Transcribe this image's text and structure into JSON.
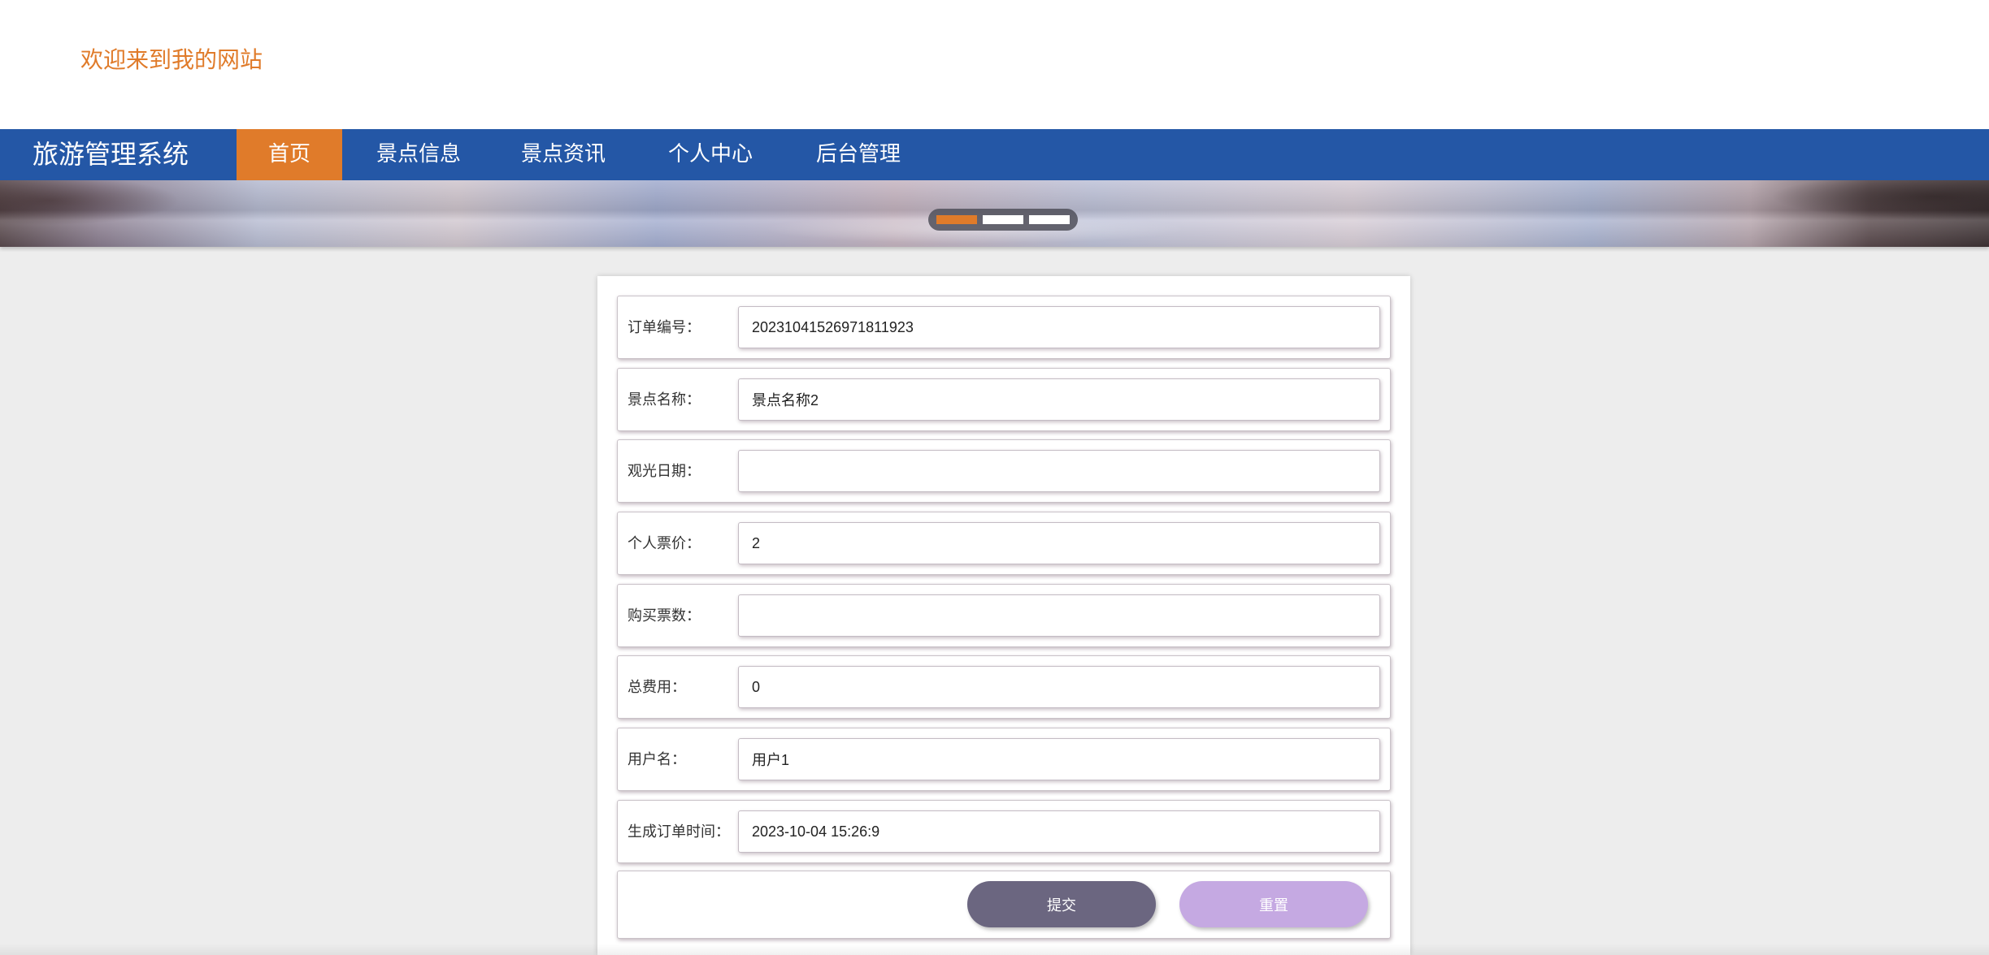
{
  "header": {
    "welcome_text": "欢迎来到我的网站"
  },
  "nav": {
    "brand": "旅游管理系统",
    "items": [
      {
        "label": "首页",
        "active": true
      },
      {
        "label": "景点信息",
        "active": false
      },
      {
        "label": "景点资讯",
        "active": false
      },
      {
        "label": "个人中心",
        "active": false
      },
      {
        "label": "后台管理",
        "active": false
      }
    ]
  },
  "carousel": {
    "slide_count": 3,
    "active_index": 0
  },
  "form": {
    "fields": [
      {
        "label": "订单编号：",
        "value": "20231041526971811923"
      },
      {
        "label": "景点名称：",
        "value": "景点名称2"
      },
      {
        "label": "观光日期：",
        "value": ""
      },
      {
        "label": "个人票价：",
        "value": "2"
      },
      {
        "label": "购买票数：",
        "value": ""
      },
      {
        "label": "总费用：",
        "value": "0"
      },
      {
        "label": "用户名：",
        "value": "用户1"
      },
      {
        "label": "生成订单时间：",
        "value": "2023-10-04 15:26:9"
      }
    ],
    "submit_label": "提交",
    "reset_label": "重置"
  },
  "colors": {
    "nav_background": "#2457a6",
    "accent_orange": "#e07b2a",
    "submit_button": "#6b6680",
    "reset_button": "#c5a9e2"
  }
}
